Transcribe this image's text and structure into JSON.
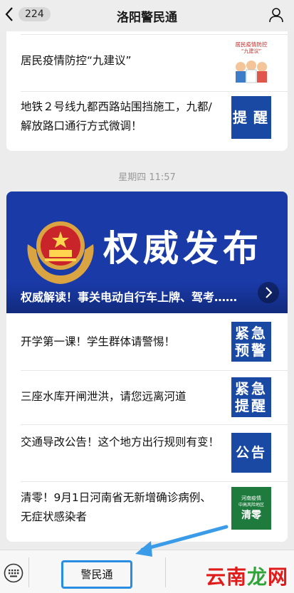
{
  "header": {
    "unread_count": "224",
    "title": "洛阳警民通"
  },
  "card_top": {
    "items": [
      {
        "title": "居民疫情防控“九建议”",
        "thumb_lines": [
          "居民疫情防控",
          "“九建议”"
        ]
      },
      {
        "title": "地铁２号线九都西路站围挡施工，九都/解放路口通行方式微调！",
        "thumb_lines": [
          "提",
          "醒"
        ]
      }
    ]
  },
  "timestamp": "星期四 11:57",
  "banner": {
    "headline": "权威发布",
    "caption": "权威解读！事关电动自行车上牌、驾考……"
  },
  "card_main": {
    "items": [
      {
        "title": "开学第一课！学生群体请警惕！",
        "thumb_lines": [
          "紧急",
          "预警"
        ]
      },
      {
        "title": "三座水库开闸泄洪，请您远离河道",
        "thumb_lines": [
          "紧急",
          "提醒"
        ]
      },
      {
        "title": "交通导改公告！这个地方出行规则有变！",
        "thumb_lines": [
          "公告"
        ]
      },
      {
        "title": "清零！9月1日河南省无新增确诊病例、无症状感染者",
        "thumb_lines": [
          "河南疫情",
          "中高风险地区",
          "清零"
        ]
      }
    ]
  },
  "bottom_bar": {
    "menu_label": "警民通",
    "watermark_part1": "云南",
    "watermark_part2": "龙",
    "watermark_part3": "网"
  },
  "colors": {
    "accent_blue": "#1a49a3",
    "highlight": "#2b8de2",
    "watermark_red": "#e01b1b"
  }
}
